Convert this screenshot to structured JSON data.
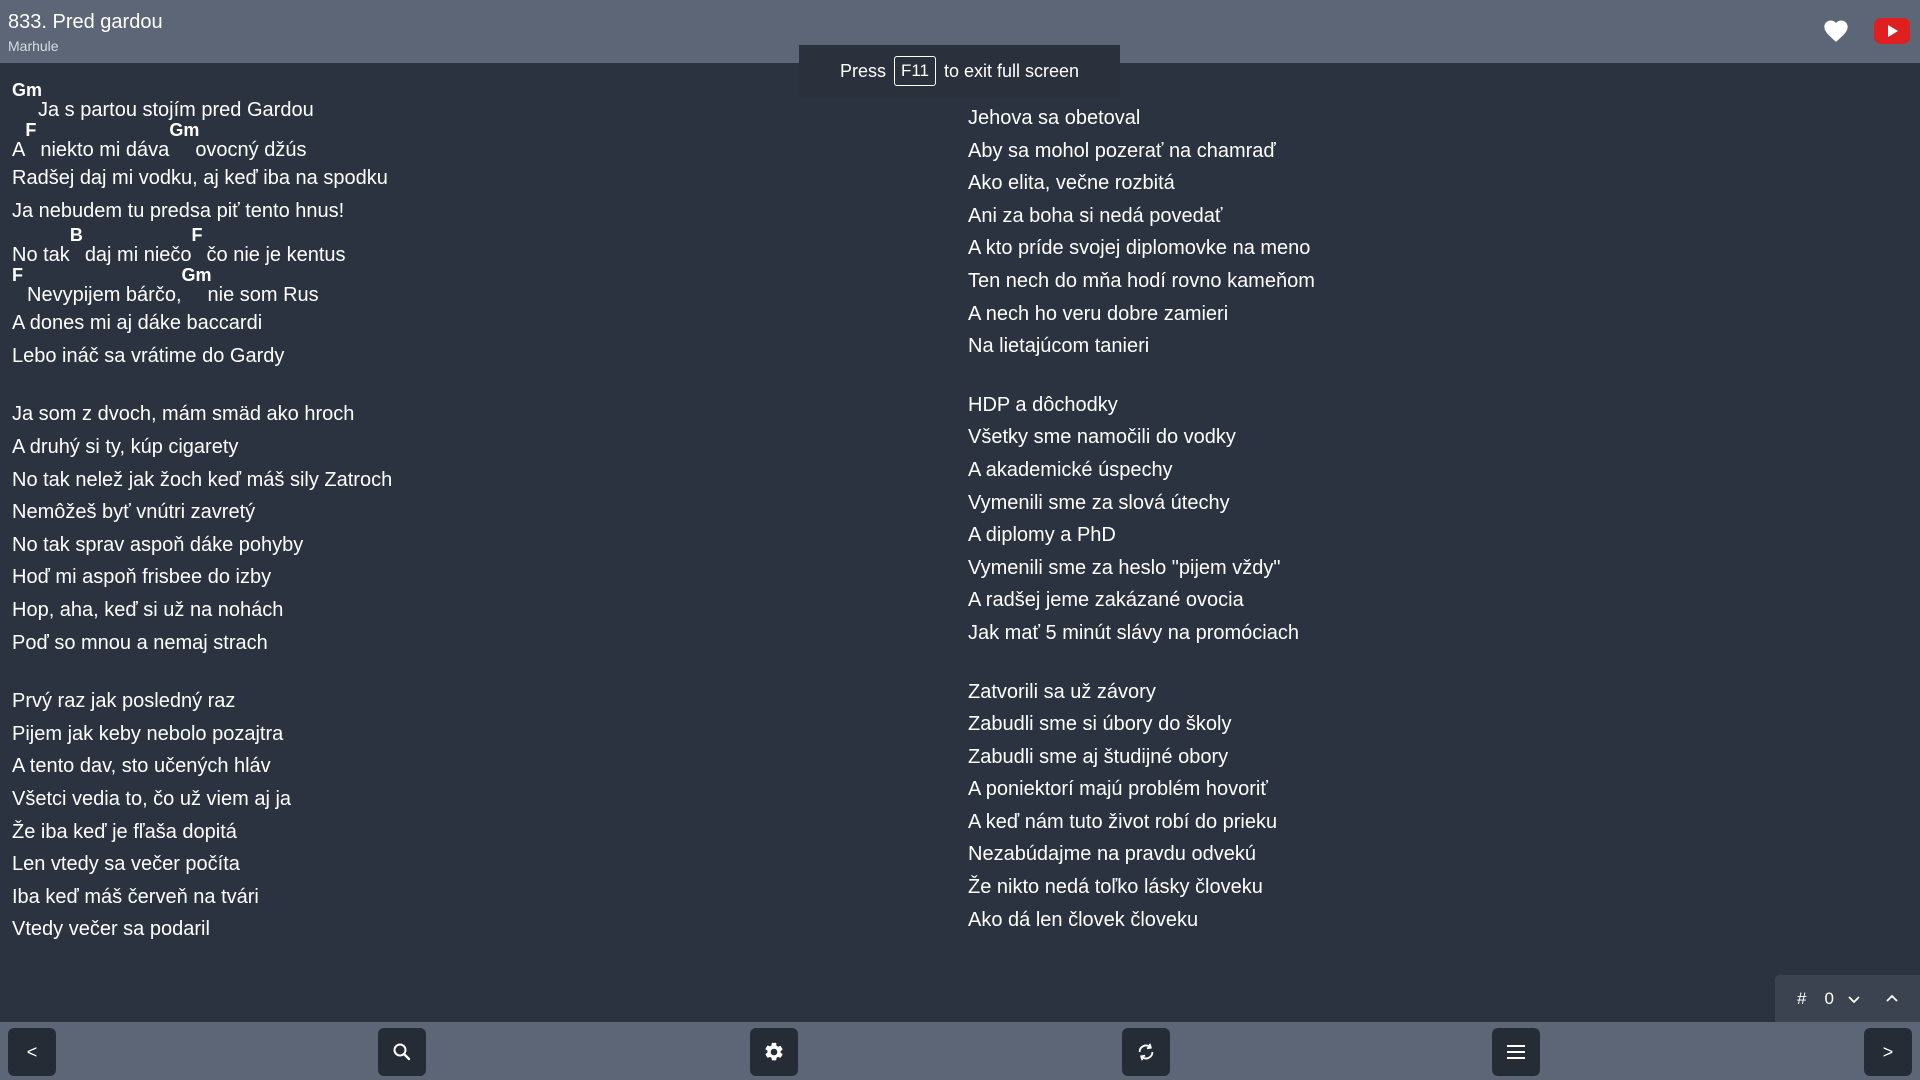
{
  "header": {
    "title": "833. Pred gardou",
    "artist": "Marhule"
  },
  "fullscreen_banner": {
    "before": "Press",
    "key": "F11",
    "after": "to exit full screen"
  },
  "lyrics": {
    "left_column": [
      {
        "segments": [
          {
            "chord": "Gm",
            "text": "Ja s partou stojím pred Gardou"
          }
        ]
      },
      {
        "segments": [
          {
            "chord": "",
            "text": "A "
          },
          {
            "chord": "F",
            "text": "niekto mi dáva "
          },
          {
            "chord": "Gm",
            "text": "ovocný džús"
          }
        ]
      },
      {
        "segments": [
          {
            "chord": "",
            "text": "Radšej daj mi vodku, aj keď iba na spodku"
          }
        ]
      },
      {
        "segments": [
          {
            "chord": "",
            "text": "Ja nebudem tu predsa piť tento hnus!"
          }
        ]
      },
      {
        "segments": [
          {
            "chord": "",
            "text": "No tak "
          },
          {
            "chord": "B",
            "text": "daj mi niečo "
          },
          {
            "chord": "F",
            "text": "čo nie je kentus"
          }
        ]
      },
      {
        "segments": [
          {
            "chord": "F",
            "text": "Nevypijem bárčo, "
          },
          {
            "chord": "Gm",
            "text": "nie som Rus"
          }
        ]
      },
      {
        "segments": [
          {
            "chord": "",
            "text": "A dones mi aj dáke baccardi"
          }
        ]
      },
      {
        "segments": [
          {
            "chord": "",
            "text": "Lebo ináč sa vrátime do Gardy"
          }
        ]
      },
      {
        "gap": true
      },
      {
        "segments": [
          {
            "chord": "",
            "text": "Ja som z dvoch, mám smäd ako hroch"
          }
        ]
      },
      {
        "segments": [
          {
            "chord": "",
            "text": "A druhý si ty, kúp cigarety"
          }
        ]
      },
      {
        "segments": [
          {
            "chord": "",
            "text": "No tak nelež jak žoch keď máš sily Zatroch"
          }
        ]
      },
      {
        "segments": [
          {
            "chord": "",
            "text": "Nemôžeš byť vnútri zavretý"
          }
        ]
      },
      {
        "segments": [
          {
            "chord": "",
            "text": "No tak sprav aspoň dáke pohyby"
          }
        ]
      },
      {
        "segments": [
          {
            "chord": "",
            "text": "Hoď mi aspoň frisbee do izby"
          }
        ]
      },
      {
        "segments": [
          {
            "chord": "",
            "text": "Hop, aha, keď si už na nohách"
          }
        ]
      },
      {
        "segments": [
          {
            "chord": "",
            "text": "Poď so mnou a nemaj strach"
          }
        ]
      },
      {
        "gap": true
      },
      {
        "segments": [
          {
            "chord": "",
            "text": "Prvý raz jak posledný raz"
          }
        ]
      },
      {
        "segments": [
          {
            "chord": "",
            "text": "Pijem jak keby nebolo pozajtra"
          }
        ]
      },
      {
        "segments": [
          {
            "chord": "",
            "text": "A tento dav, sto učených hláv"
          }
        ]
      },
      {
        "segments": [
          {
            "chord": "",
            "text": "Všetci vedia to, čo už viem aj ja"
          }
        ]
      },
      {
        "segments": [
          {
            "chord": "",
            "text": "Že iba keď je fľaša dopitá"
          }
        ]
      },
      {
        "segments": [
          {
            "chord": "",
            "text": "Len vtedy sa večer počíta"
          }
        ]
      },
      {
        "segments": [
          {
            "chord": "",
            "text": "Iba keď máš červeň na tvári"
          }
        ]
      },
      {
        "segments": [
          {
            "chord": "",
            "text": "Vtedy večer sa podaril"
          }
        ]
      }
    ],
    "right_column": [
      {
        "segments": [
          {
            "chord": "",
            "text": "Jehova sa obetoval"
          }
        ]
      },
      {
        "segments": [
          {
            "chord": "",
            "text": "Aby sa mohol pozerať na chamraď"
          }
        ]
      },
      {
        "segments": [
          {
            "chord": "",
            "text": "Ako elita, večne rozbitá"
          }
        ]
      },
      {
        "segments": [
          {
            "chord": "",
            "text": "Ani za boha si nedá povedať"
          }
        ]
      },
      {
        "segments": [
          {
            "chord": "",
            "text": "A kto príde svojej diplomovke na meno"
          }
        ]
      },
      {
        "segments": [
          {
            "chord": "",
            "text": "Ten nech do mňa hodí rovno kameňom"
          }
        ]
      },
      {
        "segments": [
          {
            "chord": "",
            "text": "A nech ho veru dobre zamieri"
          }
        ]
      },
      {
        "segments": [
          {
            "chord": "",
            "text": "Na lietajúcom tanieri"
          }
        ]
      },
      {
        "gap": true
      },
      {
        "segments": [
          {
            "chord": "",
            "text": "HDP a dôchodky"
          }
        ]
      },
      {
        "segments": [
          {
            "chord": "",
            "text": "Všetky sme namočili do vodky"
          }
        ]
      },
      {
        "segments": [
          {
            "chord": "",
            "text": "A akademické úspechy"
          }
        ]
      },
      {
        "segments": [
          {
            "chord": "",
            "text": "Vymenili sme za slová útechy"
          }
        ]
      },
      {
        "segments": [
          {
            "chord": "",
            "text": "A diplomy a PhD"
          }
        ]
      },
      {
        "segments": [
          {
            "chord": "",
            "text": "Vymenili sme za heslo \"pijem vždy\""
          }
        ]
      },
      {
        "segments": [
          {
            "chord": "",
            "text": "A radšej jeme zakázané ovocia"
          }
        ]
      },
      {
        "segments": [
          {
            "chord": "",
            "text": "Jak mať 5 minút slávy na promóciach"
          }
        ]
      },
      {
        "gap": true
      },
      {
        "segments": [
          {
            "chord": "",
            "text": "Zatvorili sa už závory"
          }
        ]
      },
      {
        "segments": [
          {
            "chord": "",
            "text": "Zabudli sme si úbory do školy"
          }
        ]
      },
      {
        "segments": [
          {
            "chord": "",
            "text": "Zabudli sme aj študijné obory"
          }
        ]
      },
      {
        "segments": [
          {
            "chord": "",
            "text": "A poniektorí majú problém hovoriť"
          }
        ]
      },
      {
        "segments": [
          {
            "chord": "",
            "text": "A keď nám tuto život robí do prieku"
          }
        ]
      },
      {
        "segments": [
          {
            "chord": "",
            "text": "Nezabúdajme na pravdu odvekú"
          }
        ]
      },
      {
        "segments": [
          {
            "chord": "",
            "text": "Že nikto nedá toľko lásky človeku"
          }
        ]
      },
      {
        "segments": [
          {
            "chord": "",
            "text": "Ako dá len človek človeku"
          }
        ]
      }
    ]
  },
  "capo": {
    "symbol": "#",
    "value": "0"
  },
  "footer": {
    "prev_label": "<",
    "next_label": ">"
  },
  "colors": {
    "background": "#2b3340",
    "bars": "#5c6676",
    "button": "#252c36",
    "youtube": "#e02020"
  },
  "icons": [
    "heart-icon",
    "youtube-icon",
    "chevron-down-icon",
    "chevron-up-icon",
    "search-icon",
    "gear-icon",
    "sync-icon",
    "menu-icon"
  ]
}
